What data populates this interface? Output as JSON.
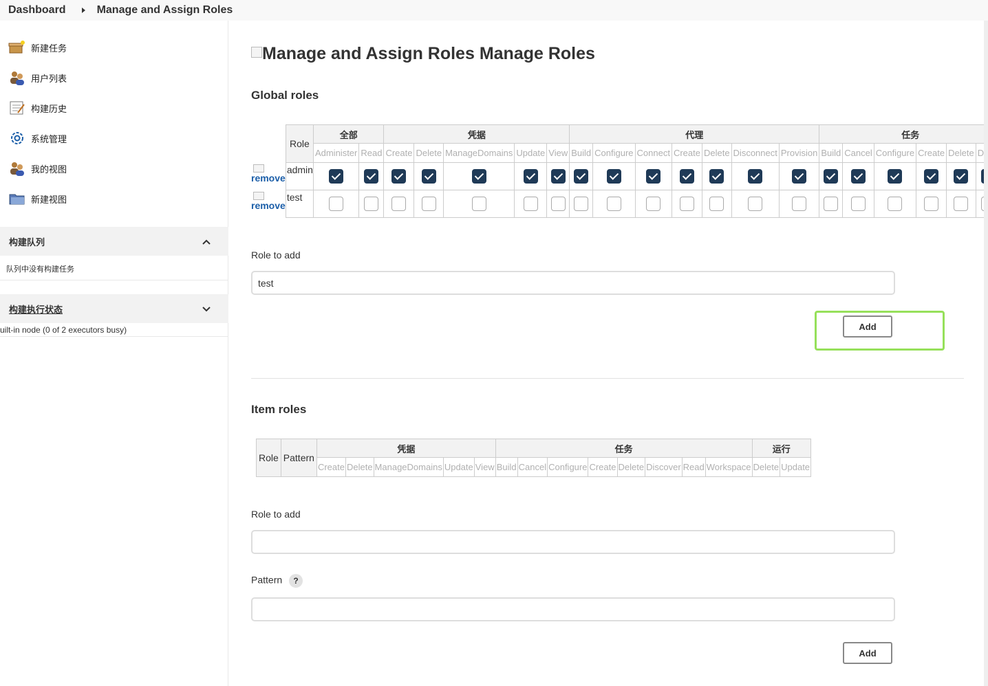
{
  "breadcrumb": {
    "home": "Dashboard",
    "current": "Manage and Assign Roles"
  },
  "sidebar": {
    "tasks": [
      {
        "label": "新建任务",
        "icon": "new-item-icon"
      },
      {
        "label": "用户列表",
        "icon": "users-icon"
      },
      {
        "label": "构建历史",
        "icon": "notepad-icon"
      },
      {
        "label": "系统管理",
        "icon": "gear-icon"
      },
      {
        "label": "我的视图",
        "icon": "users-icon"
      },
      {
        "label": "新建视图",
        "icon": "folder-icon"
      }
    ],
    "build_queue": {
      "title": "构建队列",
      "empty_text": "队列中没有构建任务"
    },
    "executor_status": {
      "title": "构建执行状态",
      "node_text": "uilt-in node (0 of 2 executors busy)"
    }
  },
  "page": {
    "image_alt": "Manage and Assign Roles",
    "title": "Manage Roles"
  },
  "global_roles": {
    "heading": "Global roles",
    "role_header": "Role",
    "groups": [
      {
        "name": "全部",
        "perms": [
          "Administer",
          "Read"
        ]
      },
      {
        "name": "凭据",
        "perms": [
          "Create",
          "Delete",
          "ManageDomains",
          "Update",
          "View"
        ]
      },
      {
        "name": "代理",
        "perms": [
          "Build",
          "Configure",
          "Connect",
          "Create",
          "Delete",
          "Disconnect",
          "Provision"
        ]
      },
      {
        "name": "任务",
        "perms": [
          "Build",
          "Cancel",
          "Configure",
          "Create",
          "Delete",
          "Disco"
        ]
      }
    ],
    "remove_label": "remove",
    "rows": [
      {
        "name": "admin",
        "checked": true
      },
      {
        "name": "test",
        "checked": false
      }
    ],
    "role_to_add_label": "Role to add",
    "role_to_add_value": "test",
    "add_label": "Add"
  },
  "item_roles": {
    "heading": "Item roles",
    "role_header": "Role",
    "pattern_header": "Pattern",
    "groups": [
      {
        "name": "凭据",
        "perms": [
          "Create",
          "Delete",
          "ManageDomains",
          "Update",
          "View"
        ]
      },
      {
        "name": "任务",
        "perms": [
          "Build",
          "Cancel",
          "Configure",
          "Create",
          "Delete",
          "Discover",
          "Read",
          "Workspace"
        ]
      },
      {
        "name": "运行",
        "perms": [
          "Delete",
          "Update"
        ]
      }
    ],
    "role_to_add_label": "Role to add",
    "role_to_add_value": "",
    "pattern_label": "Pattern",
    "help_symbol": "?",
    "pattern_value": "",
    "add_label": "Add"
  },
  "colors": {
    "checkbox_checked": "#1f3a57",
    "link": "#1b5ea8",
    "highlight": "#96e05a"
  }
}
